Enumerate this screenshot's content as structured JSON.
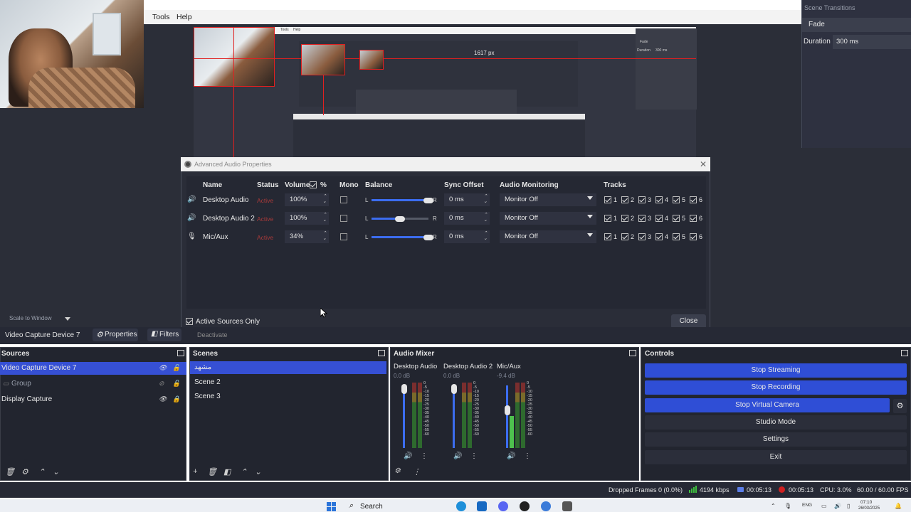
{
  "menubar": {
    "tools": "Tools",
    "help": "Help"
  },
  "transitions": {
    "title": "Scene Transitions",
    "type": "Fade",
    "duration_label": "Duration",
    "duration_value": "300 ms"
  },
  "nested": {
    "size_text": "1617 px",
    "menu_tools": "Tools",
    "menu_help": "Help",
    "fade": "Fade",
    "duration": "Duration",
    "ms": "300 ms"
  },
  "dialog": {
    "title": "Advanced Audio Properties",
    "headers": {
      "name": "Name",
      "status": "Status",
      "volume": "Volume",
      "percent": "%",
      "mono": "Mono",
      "balance": "Balance",
      "sync": "Sync Offset",
      "monitoring": "Audio Monitoring",
      "tracks": "Tracks"
    },
    "rows": [
      {
        "name": "Desktop Audio",
        "status": "Active",
        "volume": "100%",
        "sync": "0 ms",
        "monitoring": "Monitor Off",
        "balance": 1.0
      },
      {
        "name": "Desktop Audio 2",
        "status": "Active",
        "volume": "100%",
        "sync": "0 ms",
        "monitoring": "Monitor Off",
        "balance": 0.5
      },
      {
        "name": "Mic/Aux",
        "status": "Active",
        "volume": "34%",
        "sync": "0 ms",
        "monitoring": "Monitor Off",
        "balance": 1.0
      }
    ],
    "track_numbers": [
      "1",
      "2",
      "3",
      "4",
      "5",
      "6"
    ],
    "balance_L": "L",
    "balance_R": "R",
    "active_only_label": "Active Sources Only",
    "close_label": "Close"
  },
  "preview": {
    "scale_label": "Scale to Window"
  },
  "source_toolbar": {
    "selected_source": "Video Capture Device 7",
    "properties": "Properties",
    "filters": "Filters",
    "deactivate": "Deactivate"
  },
  "docks": {
    "sources": {
      "title": "Sources",
      "items": [
        "Video Capture Device 7",
        "Group",
        "Display Capture"
      ]
    },
    "scenes": {
      "title": "Scenes",
      "items": [
        "مشهد",
        "Scene 2",
        "Scene 3"
      ]
    },
    "mixer": {
      "title": "Audio Mixer",
      "channels": [
        {
          "name": "Desktop Audio",
          "db": "0.0 dB",
          "level": 0.0
        },
        {
          "name": "Desktop Audio 2",
          "db": "0.0 dB",
          "level": 0.0
        },
        {
          "name": "Mic/Aux",
          "db": "-9.4 dB",
          "level": 0.34
        }
      ],
      "scale": [
        "0",
        "-5",
        "-10",
        "-15",
        "-20",
        "-25",
        "-30",
        "-35",
        "-40",
        "-45",
        "-50",
        "-55",
        "-60"
      ]
    },
    "controls": {
      "title": "Controls",
      "stop_streaming": "Stop Streaming",
      "stop_recording": "Stop Recording",
      "stop_virtual_camera": "Stop Virtual Camera",
      "studio_mode": "Studio Mode",
      "settings": "Settings",
      "exit": "Exit"
    }
  },
  "statusbar": {
    "dropped": "Dropped Frames 0 (0.0%)",
    "bitrate": "4194 kbps",
    "stream_time": "00:05:13",
    "rec_time": "00:05:13",
    "cpu": "CPU: 3.0%",
    "fps": "60.00 / 60.00 FPS"
  },
  "taskbar": {
    "search": "Search",
    "lang": "ENG",
    "time": "07:10",
    "date": "26/03/2025"
  },
  "colors": {
    "accent": "#3650d4",
    "control_active": "#2f4ed6",
    "bg": "#22252f",
    "status_red": "#a83a3a"
  }
}
